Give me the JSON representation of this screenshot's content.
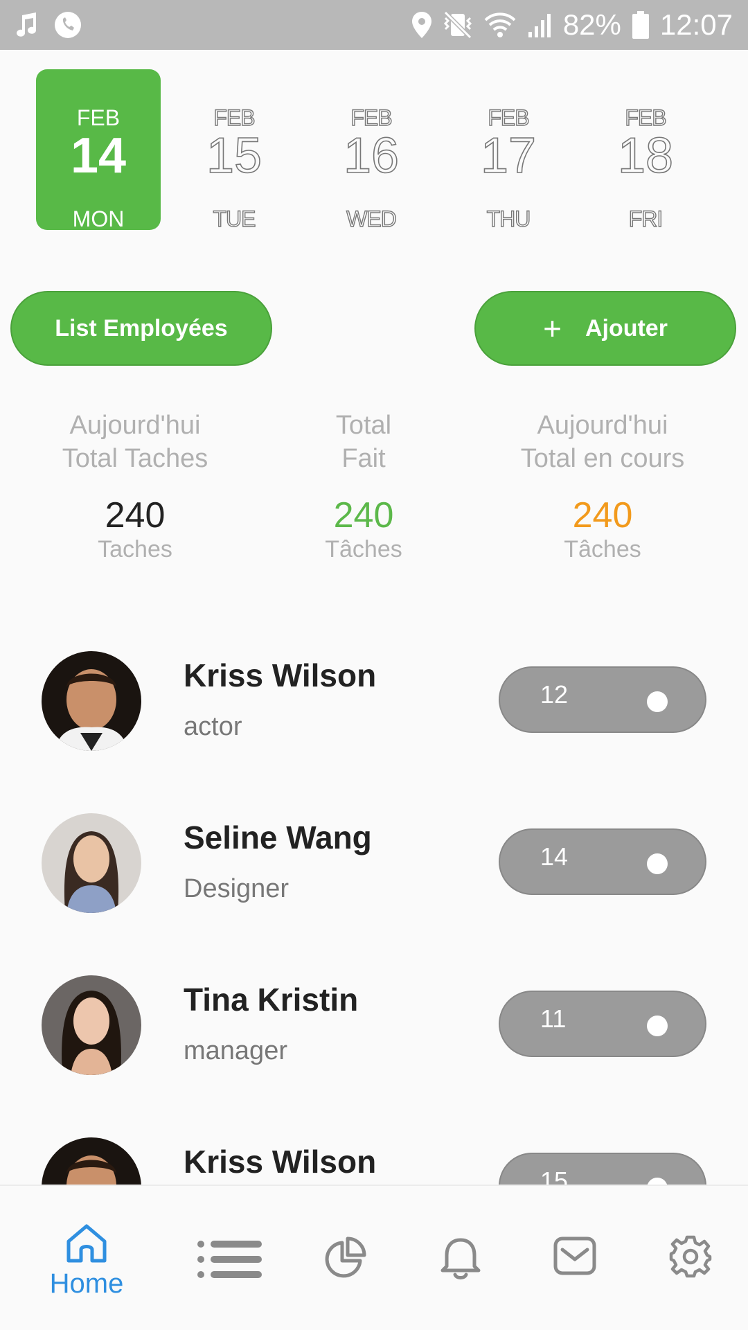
{
  "status_bar": {
    "battery": "82%",
    "time": "12:07",
    "icons": [
      "music-note-icon",
      "phone-icon",
      "location-icon",
      "vibrate-mute-icon",
      "wifi-icon",
      "signal-icon",
      "battery-icon"
    ]
  },
  "dates": [
    {
      "month": "FEB",
      "day": "14",
      "weekday": "MON",
      "selected": true
    },
    {
      "month": "FEB",
      "day": "15",
      "weekday": "TUE",
      "selected": false
    },
    {
      "month": "FEB",
      "day": "16",
      "weekday": "WED",
      "selected": false
    },
    {
      "month": "FEB",
      "day": "17",
      "weekday": "THU",
      "selected": false
    },
    {
      "month": "FEB",
      "day": "18",
      "weekday": "FRI",
      "selected": false
    }
  ],
  "actions": {
    "list_label": "List Employées",
    "add_label": "Ajouter",
    "add_icon": "plus-icon"
  },
  "stats": [
    {
      "line1": "Aujourd'hui",
      "line2": "Total Taches",
      "value": "240",
      "unit": "Taches",
      "color": "#222222"
    },
    {
      "line1": "Total",
      "line2": "Fait",
      "value": "240",
      "unit": "Tâches",
      "color": "#5cb84a"
    },
    {
      "line1": "Aujourd'hui",
      "line2": "Total en cours",
      "value": "240",
      "unit": "Tâches",
      "color": "#f29a1c"
    }
  ],
  "employees": [
    {
      "name": "Kriss Wilson",
      "role": "actor",
      "count": "12"
    },
    {
      "name": "Seline Wang",
      "role": "Designer",
      "count": "14"
    },
    {
      "name": "Tina Kristin",
      "role": "manager",
      "count": "11"
    },
    {
      "name": "Kriss Wilson",
      "role": "",
      "count": "15"
    }
  ],
  "nav": {
    "home_label": "Home",
    "items": [
      "home-icon",
      "list-icon",
      "pie-chart-icon",
      "bell-icon",
      "mail-icon",
      "settings-icon"
    ],
    "active_color": "#2f8fe0",
    "inactive_color": "#8a8a8a"
  },
  "colors": {
    "accent": "#58b947",
    "status_bar": "#b8b8b8",
    "pill": "#9b9b9b"
  }
}
